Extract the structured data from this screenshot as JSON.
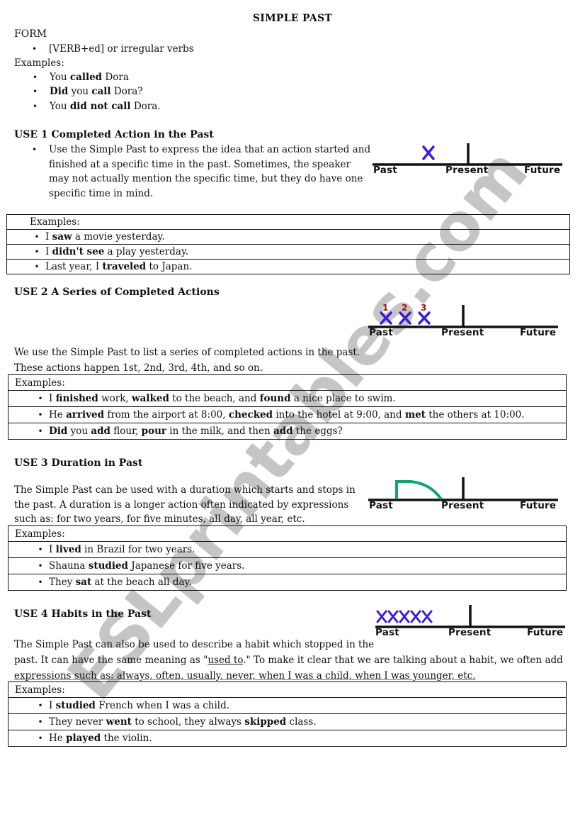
{
  "title": "SIMPLE PAST",
  "watermark": "ESLprintables.com",
  "form": {
    "heading": "FORM",
    "rule": "[VERB+ed] or irregular verbs",
    "examples_label": "Examples:",
    "examples": [
      [
        {
          "t": "You "
        },
        {
          "t": "called",
          "b": true
        },
        {
          "t": " Dora"
        }
      ],
      [
        {
          "t": "Did",
          "b": true
        },
        {
          "t": " you "
        },
        {
          "t": "call",
          "b": true
        },
        {
          "t": " Dora?"
        }
      ],
      [
        {
          "t": "You "
        },
        {
          "t": "did not call",
          "b": true
        },
        {
          "t": " Dora."
        }
      ]
    ]
  },
  "timeline_labels": {
    "past": "Past",
    "present": "Present",
    "future": "Future"
  },
  "colors": {
    "marker": "#3a1fd6",
    "duration": "#16a071",
    "number": "#a01010",
    "line": "#111111"
  },
  "uses": [
    {
      "heading": "USE 1 Completed Action in the Past",
      "description_lines": [
        "Use the Simple Past to express the idea that an action started and",
        "finished at a specific time in the past. Sometimes, the speaker",
        "may not actually mention the specific time, but they do have one",
        "specific time in mind."
      ],
      "timeline": {
        "type": "single",
        "marks": [
          "X"
        ]
      },
      "examples_label": "Examples:",
      "examples": [
        [
          {
            "t": "I "
          },
          {
            "t": "saw",
            "b": true
          },
          {
            "t": " a movie yesterday."
          }
        ],
        [
          {
            "t": "I "
          },
          {
            "t": "didn't see",
            "b": true
          },
          {
            "t": " a play yesterday."
          }
        ],
        [
          {
            "t": "Last year, I "
          },
          {
            "t": "traveled",
            "b": true
          },
          {
            "t": " to Japan."
          }
        ]
      ]
    },
    {
      "heading": "USE 2 A Series of Completed Actions",
      "description_lines": [
        "We use the Simple Past to list a series of completed actions in the past.",
        "These actions happen 1st, 2nd, 3rd, 4th, and so on."
      ],
      "timeline": {
        "type": "series",
        "marks": [
          "X",
          "X",
          "X"
        ],
        "numbers": [
          "1",
          "2",
          "3"
        ]
      },
      "examples_label": "Examples:",
      "examples": [
        [
          {
            "t": "I "
          },
          {
            "t": "finished",
            "b": true
          },
          {
            "t": " work, "
          },
          {
            "t": "walked",
            "b": true
          },
          {
            "t": " to the beach, and "
          },
          {
            "t": "found",
            "b": true
          },
          {
            "t": " a nice place to swim."
          }
        ],
        [
          {
            "t": "He "
          },
          {
            "t": "arrived",
            "b": true
          },
          {
            "t": " from the airport at 8:00, "
          },
          {
            "t": "checked",
            "b": true
          },
          {
            "t": " into the hotel at 9:00, and "
          },
          {
            "t": "met",
            "b": true
          },
          {
            "t": " the others at 10:00."
          }
        ],
        [
          {
            "t": "Did",
            "b": true
          },
          {
            "t": " you "
          },
          {
            "t": "add",
            "b": true
          },
          {
            "t": " flour, "
          },
          {
            "t": "pour",
            "b": true
          },
          {
            "t": " in the milk, and then "
          },
          {
            "t": "add",
            "b": true
          },
          {
            "t": " the eggs?"
          }
        ]
      ]
    },
    {
      "heading": "USE 3 Duration in Past",
      "description_lines": [
        "The Simple Past can be used with a duration which starts and stops in",
        "the past. A duration is a longer action often indicated by expressions",
        "such as: for two years, for five minutes, all day, all year, etc."
      ],
      "timeline": {
        "type": "duration"
      },
      "examples_label": "Examples:",
      "examples": [
        [
          {
            "t": "I "
          },
          {
            "t": "lived",
            "b": true
          },
          {
            "t": " in Brazil for two years."
          }
        ],
        [
          {
            "t": "Shauna "
          },
          {
            "t": "studied",
            "b": true
          },
          {
            "t": " Japanese for five years."
          }
        ],
        [
          {
            "t": "They "
          },
          {
            "t": "sat",
            "b": true
          },
          {
            "t": " at the beach all day."
          }
        ]
      ]
    },
    {
      "heading": "USE 4 Habits in the Past",
      "description_lines": [
        [
          {
            "t": "The Simple Past can also be used to describe a habit which stopped in the"
          }
        ],
        [
          {
            "t": "past. It can have the same meaning as \""
          },
          {
            "t": "used to",
            "u": true
          },
          {
            "t": ".\" To make it clear that we are talking about a habit, we often add"
          }
        ],
        [
          {
            "t": "expressions such as: always, often, usually, never, when I was a child, when I was younger, etc."
          }
        ]
      ],
      "timeline": {
        "type": "habit",
        "marks": "XXXXX"
      },
      "examples_label": "Examples:",
      "examples": [
        [
          {
            "t": "I "
          },
          {
            "t": "studied",
            "b": true
          },
          {
            "t": " French when I was a child."
          }
        ],
        [
          {
            "t": "They never "
          },
          {
            "t": "went",
            "b": true
          },
          {
            "t": " to school, they always "
          },
          {
            "t": "skipped",
            "b": true
          },
          {
            "t": " class."
          }
        ],
        [
          {
            "t": "He "
          },
          {
            "t": "played",
            "b": true
          },
          {
            "t": " the violin."
          }
        ]
      ]
    }
  ]
}
